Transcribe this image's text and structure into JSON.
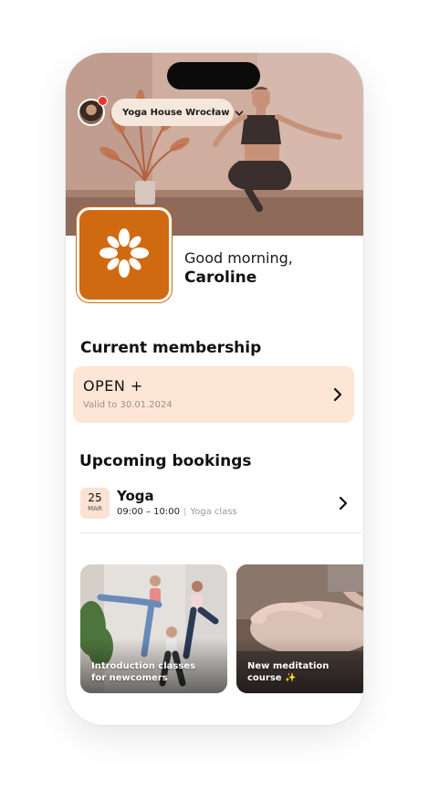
{
  "header": {
    "studio_name": "Yoga House Wrocław"
  },
  "greeting": {
    "line1": "Good morning,",
    "name": "Caroline"
  },
  "membership": {
    "section_title": "Current membership",
    "plan_name": "OPEN +",
    "valid_text": "Valid to 30.01.2024"
  },
  "bookings": {
    "section_title": "Upcoming bookings",
    "items": [
      {
        "day": "25",
        "month": "MAR",
        "title": "Yoga",
        "time": "09:00 – 10:00",
        "kind": "Yoga class"
      }
    ]
  },
  "promos": [
    {
      "caption_line1": "Introduction classes",
      "caption_line2": "for newcomers"
    },
    {
      "caption_line1": "New meditation",
      "caption_line2": "course ✨"
    }
  ],
  "colors": {
    "brand": "#d06a10",
    "membership_bg": "#fde6d6",
    "date_badge_bg": "#fbe2d2",
    "notification_dot": "#e2382d"
  },
  "icons": {
    "logo": "lotus-flower-icon",
    "dropdown": "chevron-down-icon",
    "navigate": "chevron-right-icon"
  }
}
